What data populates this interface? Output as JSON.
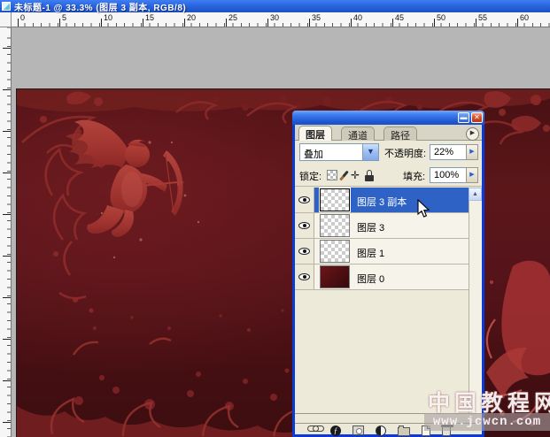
{
  "window": {
    "title": "未标题-1 @ 33.3% (图层 3 副本, RGB/8)"
  },
  "ruler": {
    "h_labels": [
      "0",
      "5",
      "10",
      "15",
      "20",
      "25",
      "30",
      "35",
      "40",
      "45",
      "50",
      "55",
      "60"
    ]
  },
  "panel": {
    "tabs": [
      {
        "label": "图层",
        "active": true
      },
      {
        "label": "通道",
        "active": false
      },
      {
        "label": "路径",
        "active": false
      }
    ],
    "blend_mode": "叠加",
    "opacity_label": "不透明度:",
    "opacity_value": "22%",
    "lock_label": "锁定:",
    "fill_label": "填充:",
    "fill_value": "100%",
    "layers": [
      {
        "name": "图层 3 副本",
        "selected": true,
        "thumb": "checker"
      },
      {
        "name": "图层 3",
        "selected": false,
        "thumb": "checker"
      },
      {
        "name": "图层 1",
        "selected": false,
        "thumb": "checker"
      },
      {
        "name": "图层 0",
        "selected": false,
        "thumb": "dark-red"
      }
    ],
    "bottom_icons": [
      "link",
      "layer-style",
      "layer-mask",
      "adjustment-layer",
      "group",
      "new-layer",
      "delete-layer"
    ]
  },
  "watermark": {
    "line1": "中国教程网",
    "line2": "www.jcwcn.com"
  },
  "colors": {
    "titlebar_blue": "#2b66e0",
    "panel_face": "#ece9d8",
    "selection_blue": "#2e63c5",
    "canvas_maroon": "#56141a",
    "cupid_red": "#a83a36",
    "workspace_gray": "#b6b6b6"
  }
}
